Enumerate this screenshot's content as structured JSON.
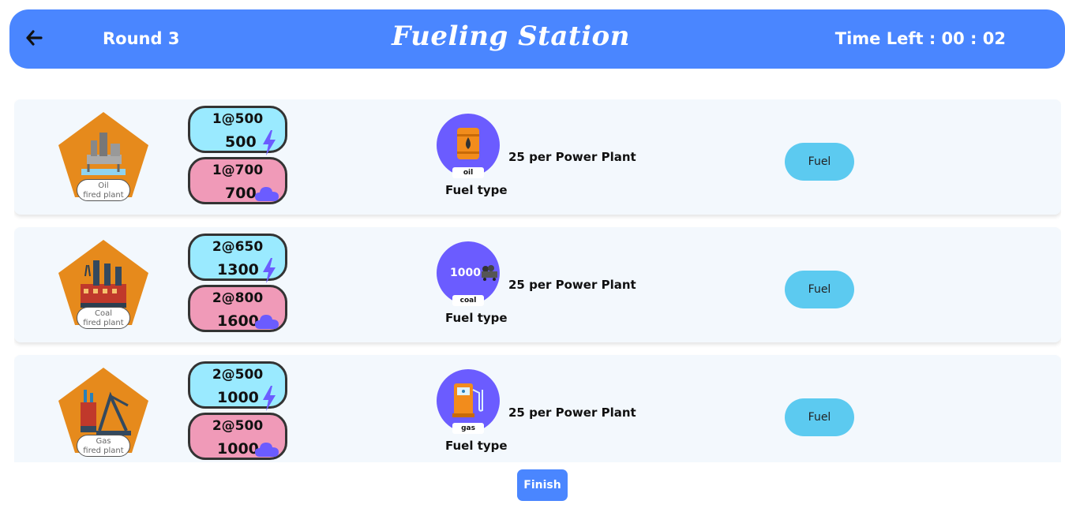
{
  "header": {
    "round_label": "Round 3",
    "title": "Fueling Station",
    "timer_label": "Time Left : 00 : 02"
  },
  "plants": [
    {
      "name_line1": "Oil",
      "name_line2": "fired plant",
      "power_rate": "1@500",
      "power_total": "500",
      "emission_rate": "1@700",
      "emission_total": "700",
      "fuel_tag": "oil",
      "fuel_qty": "",
      "fuel_type_label": "Fuel type",
      "per_plant": "25 per Power Plant",
      "fuel_button": "Fuel"
    },
    {
      "name_line1": "Coal",
      "name_line2": "fired plant",
      "power_rate": "2@650",
      "power_total": "1300",
      "emission_rate": "2@800",
      "emission_total": "1600",
      "fuel_tag": "coal",
      "fuel_qty": "1000",
      "fuel_type_label": "Fuel type",
      "per_plant": "25 per Power Plant",
      "fuel_button": "Fuel"
    },
    {
      "name_line1": "Gas",
      "name_line2": "fired plant",
      "power_rate": "2@500",
      "power_total": "1000",
      "emission_rate": "2@500",
      "emission_total": "1000",
      "fuel_tag": "gas",
      "fuel_qty": "",
      "fuel_type_label": "Fuel type",
      "per_plant": "25 per Power Plant",
      "fuel_button": "Fuel"
    }
  ],
  "footer": {
    "finish_label": "Finish"
  },
  "colors": {
    "header": "#4a86ff",
    "plant_pentagon": "#e68a1c",
    "power_pill": "#9aeaff",
    "emission_pill": "#f09ab8",
    "fuel_circle": "#6b5cff",
    "fuel_button": "#5ccaf0"
  },
  "icons": [
    "back-arrow-icon",
    "oil-rig-icon",
    "coal-factory-icon",
    "gas-plant-icon",
    "lightning-icon",
    "cloud-icon",
    "oil-barrel-icon",
    "coal-cart-icon",
    "gas-pump-icon"
  ]
}
